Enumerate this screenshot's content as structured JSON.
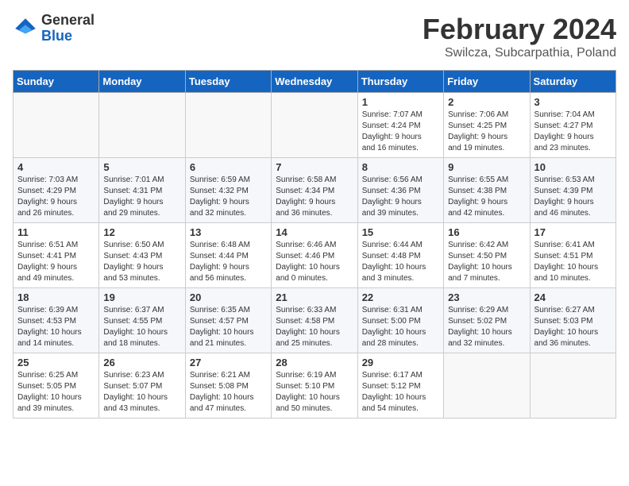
{
  "logo": {
    "general": "General",
    "blue": "Blue"
  },
  "header": {
    "month": "February 2024",
    "location": "Swilcza, Subcarpathia, Poland"
  },
  "days_of_week": [
    "Sunday",
    "Monday",
    "Tuesday",
    "Wednesday",
    "Thursday",
    "Friday",
    "Saturday"
  ],
  "weeks": [
    [
      {
        "day": "",
        "info": ""
      },
      {
        "day": "",
        "info": ""
      },
      {
        "day": "",
        "info": ""
      },
      {
        "day": "",
        "info": ""
      },
      {
        "day": "1",
        "info": "Sunrise: 7:07 AM\nSunset: 4:24 PM\nDaylight: 9 hours\nand 16 minutes."
      },
      {
        "day": "2",
        "info": "Sunrise: 7:06 AM\nSunset: 4:25 PM\nDaylight: 9 hours\nand 19 minutes."
      },
      {
        "day": "3",
        "info": "Sunrise: 7:04 AM\nSunset: 4:27 PM\nDaylight: 9 hours\nand 23 minutes."
      }
    ],
    [
      {
        "day": "4",
        "info": "Sunrise: 7:03 AM\nSunset: 4:29 PM\nDaylight: 9 hours\nand 26 minutes."
      },
      {
        "day": "5",
        "info": "Sunrise: 7:01 AM\nSunset: 4:31 PM\nDaylight: 9 hours\nand 29 minutes."
      },
      {
        "day": "6",
        "info": "Sunrise: 6:59 AM\nSunset: 4:32 PM\nDaylight: 9 hours\nand 32 minutes."
      },
      {
        "day": "7",
        "info": "Sunrise: 6:58 AM\nSunset: 4:34 PM\nDaylight: 9 hours\nand 36 minutes."
      },
      {
        "day": "8",
        "info": "Sunrise: 6:56 AM\nSunset: 4:36 PM\nDaylight: 9 hours\nand 39 minutes."
      },
      {
        "day": "9",
        "info": "Sunrise: 6:55 AM\nSunset: 4:38 PM\nDaylight: 9 hours\nand 42 minutes."
      },
      {
        "day": "10",
        "info": "Sunrise: 6:53 AM\nSunset: 4:39 PM\nDaylight: 9 hours\nand 46 minutes."
      }
    ],
    [
      {
        "day": "11",
        "info": "Sunrise: 6:51 AM\nSunset: 4:41 PM\nDaylight: 9 hours\nand 49 minutes."
      },
      {
        "day": "12",
        "info": "Sunrise: 6:50 AM\nSunset: 4:43 PM\nDaylight: 9 hours\nand 53 minutes."
      },
      {
        "day": "13",
        "info": "Sunrise: 6:48 AM\nSunset: 4:44 PM\nDaylight: 9 hours\nand 56 minutes."
      },
      {
        "day": "14",
        "info": "Sunrise: 6:46 AM\nSunset: 4:46 PM\nDaylight: 10 hours\nand 0 minutes."
      },
      {
        "day": "15",
        "info": "Sunrise: 6:44 AM\nSunset: 4:48 PM\nDaylight: 10 hours\nand 3 minutes."
      },
      {
        "day": "16",
        "info": "Sunrise: 6:42 AM\nSunset: 4:50 PM\nDaylight: 10 hours\nand 7 minutes."
      },
      {
        "day": "17",
        "info": "Sunrise: 6:41 AM\nSunset: 4:51 PM\nDaylight: 10 hours\nand 10 minutes."
      }
    ],
    [
      {
        "day": "18",
        "info": "Sunrise: 6:39 AM\nSunset: 4:53 PM\nDaylight: 10 hours\nand 14 minutes."
      },
      {
        "day": "19",
        "info": "Sunrise: 6:37 AM\nSunset: 4:55 PM\nDaylight: 10 hours\nand 18 minutes."
      },
      {
        "day": "20",
        "info": "Sunrise: 6:35 AM\nSunset: 4:57 PM\nDaylight: 10 hours\nand 21 minutes."
      },
      {
        "day": "21",
        "info": "Sunrise: 6:33 AM\nSunset: 4:58 PM\nDaylight: 10 hours\nand 25 minutes."
      },
      {
        "day": "22",
        "info": "Sunrise: 6:31 AM\nSunset: 5:00 PM\nDaylight: 10 hours\nand 28 minutes."
      },
      {
        "day": "23",
        "info": "Sunrise: 6:29 AM\nSunset: 5:02 PM\nDaylight: 10 hours\nand 32 minutes."
      },
      {
        "day": "24",
        "info": "Sunrise: 6:27 AM\nSunset: 5:03 PM\nDaylight: 10 hours\nand 36 minutes."
      }
    ],
    [
      {
        "day": "25",
        "info": "Sunrise: 6:25 AM\nSunset: 5:05 PM\nDaylight: 10 hours\nand 39 minutes."
      },
      {
        "day": "26",
        "info": "Sunrise: 6:23 AM\nSunset: 5:07 PM\nDaylight: 10 hours\nand 43 minutes."
      },
      {
        "day": "27",
        "info": "Sunrise: 6:21 AM\nSunset: 5:08 PM\nDaylight: 10 hours\nand 47 minutes."
      },
      {
        "day": "28",
        "info": "Sunrise: 6:19 AM\nSunset: 5:10 PM\nDaylight: 10 hours\nand 50 minutes."
      },
      {
        "day": "29",
        "info": "Sunrise: 6:17 AM\nSunset: 5:12 PM\nDaylight: 10 hours\nand 54 minutes."
      },
      {
        "day": "",
        "info": ""
      },
      {
        "day": "",
        "info": ""
      }
    ]
  ]
}
